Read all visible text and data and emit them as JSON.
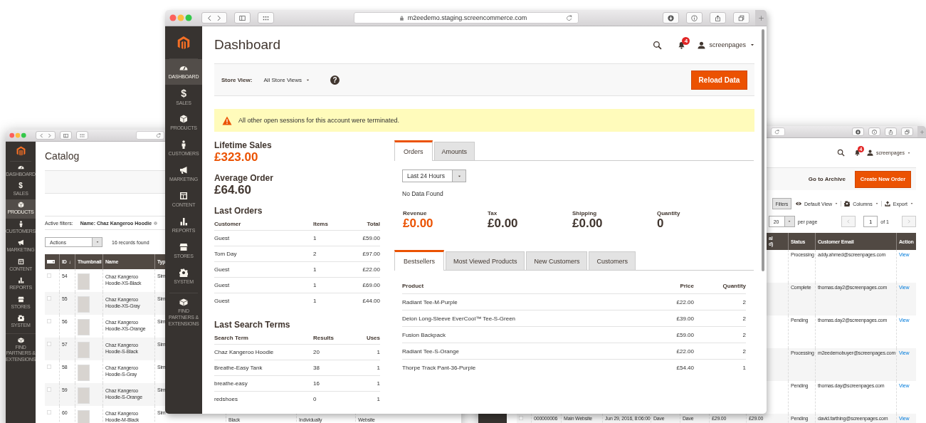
{
  "left_window": {
    "sidebar": [
      {
        "kind": "dashboard",
        "label": "DASHBOARD",
        "selected": false
      },
      {
        "kind": "sales",
        "glyph": "$",
        "label": "SALES",
        "selected": false
      },
      {
        "kind": "products",
        "label": "PRODUCTS",
        "selected": true
      },
      {
        "kind": "customers",
        "label": "CUSTOMERS",
        "selected": false
      },
      {
        "kind": "marketing",
        "label": "MARKETING",
        "selected": false
      },
      {
        "kind": "content",
        "label": "CONTENT",
        "selected": false
      },
      {
        "kind": "reports",
        "label": "REPORTS",
        "selected": false
      },
      {
        "kind": "stores",
        "label": "STORES",
        "selected": false
      },
      {
        "kind": "system",
        "label": "SYSTEM",
        "selected": false
      },
      {
        "kind": "partners",
        "label": "FIND PARTNERS & EXTENSIONS",
        "selected": false
      }
    ],
    "title": "Catalog",
    "active_filters": {
      "label": "Active filters:",
      "chip": "Name: Chaz Kangeroo Hoodie"
    },
    "actions": "Actions",
    "records": "16 records found",
    "columns": [
      "ID",
      "Thumbnail",
      "Name",
      "Typ"
    ],
    "sort_mark": "↓",
    "rows": [
      {
        "checked": false,
        "id": "54",
        "name": "Chaz Kangeroo Hoodie-XS-Black",
        "type": "Sim"
      },
      {
        "checked": false,
        "id": "55",
        "name": "Chaz Kangeroo Hoodie-XS-Gray",
        "type": "Sim"
      },
      {
        "checked": false,
        "id": "56",
        "name": "Chaz Kangeroo Hoodie-XS-Orange",
        "type": "Sim"
      },
      {
        "checked": false,
        "id": "57",
        "name": "Chaz Kangeroo Hoodie-S-Black",
        "type": "Sim"
      },
      {
        "checked": false,
        "id": "58",
        "name": "Chaz Kangeroo Hoodie-S-Gray",
        "type": "Sim"
      },
      {
        "checked": false,
        "id": "59",
        "name": "Chaz Kangeroo Hoodie-S-Orange",
        "type": "Sim"
      },
      {
        "checked": false,
        "id": "60",
        "name": "Chaz Kangeroo Hoodie-M-Black",
        "type": "Sim",
        "extra": [
          "Black",
          "Individually",
          "Website"
        ]
      }
    ]
  },
  "right_window": {
    "notifications": "4",
    "user": "screenpages",
    "archive_link": "Go to Archive",
    "create_button": "Create New Order",
    "filters_button": "Filters",
    "view": "Default View",
    "columns_button": "Columns",
    "export_button": "Export",
    "page_size": "20",
    "per_page": "per page",
    "page": "1",
    "page_of": "of 1",
    "columns": [
      "al d)",
      "Status",
      "Customer Email",
      "Action"
    ],
    "rows": [
      {
        "status": "Processing",
        "email": "addy.ahmed@screenpages.com",
        "action": "View"
      },
      {
        "status": "Complete",
        "email": "thomas.day2@screenpages.com",
        "action": "View"
      },
      {
        "status": "Pending",
        "email": "thomas.day2@screenpages.com",
        "action": "View"
      },
      {
        "status": "Processing",
        "email": "m2eedemobuyer@screenpages.com",
        "action": "View"
      },
      {
        "status": "Pending",
        "email": "thomas.day@screenpages.com",
        "action": "View"
      },
      {
        "checked": false,
        "cells": [
          "000000006",
          "Main Website",
          "Jun 29, 2016, 8:06:00",
          "Dave",
          "Dave",
          "£29.00",
          "£29.00"
        ],
        "status": "Pending",
        "email": "david.farthing@screenpages.com",
        "action": "View"
      }
    ]
  },
  "center_window": {
    "url": "m2eedemo.staging.screencommerce.com",
    "sidebar": [
      {
        "kind": "dashboard",
        "label": "DASHBOARD",
        "selected": true
      },
      {
        "kind": "sales",
        "glyph": "$",
        "label": "SALES",
        "selected": false
      },
      {
        "kind": "products",
        "label": "PRODUCTS",
        "selected": false
      },
      {
        "kind": "customers",
        "label": "CUSTOMERS",
        "selected": false
      },
      {
        "kind": "marketing",
        "label": "MARKETING",
        "selected": false
      },
      {
        "kind": "content",
        "label": "CONTENT",
        "selected": false
      },
      {
        "kind": "reports",
        "label": "REPORTS",
        "selected": false
      },
      {
        "kind": "stores",
        "label": "STORES",
        "selected": false
      },
      {
        "kind": "system",
        "label": "SYSTEM",
        "selected": false
      },
      {
        "kind": "partners",
        "label": "FIND PARTNERS & EXTENSIONS",
        "selected": false
      }
    ],
    "title": "Dashboard",
    "notifications": "4",
    "user": "screenpages",
    "store_view": {
      "label": "Store View:",
      "value": "All Store Views",
      "help": "?"
    },
    "reload_button": "Reload Data",
    "message": "All other open sessions for this account were terminated.",
    "summary": [
      {
        "label": "Lifetime Sales",
        "value": "£323.00",
        "kind": "primary"
      },
      {
        "label": "Average Order",
        "value": "£64.60",
        "kind": "plain"
      }
    ],
    "last_orders": {
      "title": "Last Orders",
      "columns": [
        "Customer",
        "Items",
        "Total"
      ],
      "rows": [
        [
          "Guest",
          "1",
          "£59.00"
        ],
        [
          "Tom Day",
          "2",
          "£97.00"
        ],
        [
          "Guest",
          "1",
          "£22.00"
        ],
        [
          "Guest",
          "1",
          "£69.00"
        ],
        [
          "Guest",
          "1",
          "£44.00"
        ]
      ]
    },
    "last_search_terms": {
      "title": "Last Search Terms",
      "columns": [
        "Search Term",
        "Results",
        "Uses"
      ],
      "rows": [
        [
          "Chaz Kangeroo Hoodie",
          "20",
          "1"
        ],
        [
          "Breathe-Easy Tank",
          "38",
          "1"
        ],
        [
          "breathe-easy",
          "16",
          "1"
        ],
        [
          "redshoes",
          "0",
          "1"
        ]
      ]
    },
    "chart_tabs": [
      {
        "label": "Orders",
        "selected": true
      },
      {
        "label": "Amounts",
        "selected": false
      }
    ],
    "period": "Last 24 Hours",
    "no_data": "No Data Found",
    "totals": [
      {
        "label": "Revenue",
        "value": "£0.00",
        "kind": "primary"
      },
      {
        "label": "Tax",
        "value": "£0.00",
        "kind": "plain"
      },
      {
        "label": "Shipping",
        "value": "£0.00",
        "kind": "plain"
      },
      {
        "label": "Quantity",
        "value": "0",
        "kind": "plain"
      }
    ],
    "grid_tabs": [
      {
        "label": "Bestsellers",
        "selected": true
      },
      {
        "label": "Most Viewed Products",
        "selected": false
      },
      {
        "label": "New Customers",
        "selected": false
      },
      {
        "label": "Customers",
        "selected": false
      }
    ],
    "bestsellers": {
      "columns": [
        "Product",
        "Price",
        "Quantity"
      ],
      "rows": [
        [
          "Radiant Tee-M-Purple",
          "£22.00",
          "2"
        ],
        [
          "Deion Long-Sleeve EverCool™ Tee-S-Green",
          "£39.00",
          "2"
        ],
        [
          "Fusion Backpack",
          "£59.00",
          "2"
        ],
        [
          "Radiant Tee-S-Orange",
          "£22.00",
          "2"
        ],
        [
          "Thorpe Track Pant-36-Purple",
          "£54.40",
          "1"
        ]
      ]
    }
  }
}
